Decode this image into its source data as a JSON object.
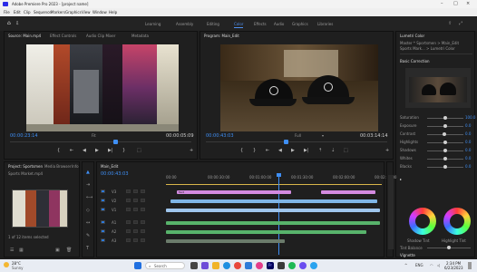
{
  "window": {
    "title": "Adobe Premiere Pro 2023 - [project name]"
  },
  "menu": [
    "File",
    "Edit",
    "Clip",
    "Sequence",
    "Markers",
    "Graphics",
    "View",
    "Window",
    "Help"
  ],
  "workspaces": [
    "Learning",
    "Assembly",
    "Editing",
    "Color",
    "Effects",
    "Audio",
    "Graphics",
    "Libraries"
  ],
  "active_workspace": "Color",
  "source": {
    "tabs": [
      "Source: Main.mp4",
      "Effect Controls",
      "Audio Clip Mixer",
      "Metadata"
    ],
    "timecode_left": "00:00:23:14",
    "timecode_right": "00:00:05:09",
    "fit": "Fit"
  },
  "program": {
    "tab": "Program: Main_Edit",
    "timecode_left": "00:00:43:03",
    "fit": "Full",
    "timecode_right": "00:03:14:14"
  },
  "transport": [
    "{",
    "⇤",
    "◀",
    "▶",
    "▶|",
    "}",
    "⬚",
    "+"
  ],
  "project": {
    "tabs": [
      "Project: Sportsmen",
      "Media Browser",
      "Info"
    ],
    "clip_name": "Sports Market.mp4",
    "item_meta": "1 of 12 items selected"
  },
  "timeline": {
    "tab": "Main_Edit",
    "timecode": "00:00:43:03",
    "ruler": [
      "00:00",
      "00:00:30:00",
      "00:01:00:00",
      "00:01:30:00",
      "00:02:00:00",
      "00:02:30:00"
    ],
    "video_tracks": [
      "V3",
      "V2",
      "V1"
    ],
    "audio_tracks": [
      "A1",
      "A2",
      "A3"
    ],
    "clips": [
      {
        "track": "V3",
        "name": "Text",
        "color": "#d38be0",
        "start": 0.05,
        "end": 0.58
      },
      {
        "track": "V3",
        "name": "",
        "color": "#d38be0",
        "start": 0.72,
        "end": 0.97
      },
      {
        "track": "V2",
        "name": "",
        "color": "#7fb5e6",
        "start": 0.02,
        "end": 0.98
      },
      {
        "track": "V1",
        "name": "",
        "color": "#9fc5ec",
        "start": 0.0,
        "end": 0.99
      },
      {
        "track": "A1",
        "name": "",
        "color": "#58b36b",
        "start": 0.0,
        "end": 0.99
      },
      {
        "track": "A2",
        "name": "",
        "color": "#58b36b",
        "start": 0.0,
        "end": 0.93
      },
      {
        "track": "A3",
        "name": "",
        "color": "#6b7b6b",
        "start": 0.0,
        "end": 0.55
      }
    ]
  },
  "lumetri": {
    "title": "Lumetri Color",
    "source_line": "Master * Sportsmen > Main_Edit",
    "clip_line": "Sports Mark... > Lumetri Color",
    "basic": "Basic Correction",
    "sliders": [
      {
        "label": "Saturation",
        "value": 0.5,
        "text": "100.0"
      },
      {
        "label": "Exposure",
        "value": 0.5,
        "text": "0.0"
      },
      {
        "label": "Contrast",
        "value": 0.48,
        "text": "0.0"
      },
      {
        "label": "Highlights",
        "value": 0.5,
        "text": "0.0"
      },
      {
        "label": "Shadows",
        "value": 0.5,
        "text": "0.0"
      },
      {
        "label": "Whites",
        "value": 0.5,
        "text": "0.0"
      },
      {
        "label": "Blacks",
        "value": 0.5,
        "text": "0.0"
      }
    ],
    "wheels": [
      "Shadow Tint",
      "Highlight Tint"
    ],
    "tint_balance": "Tint Balance",
    "vignette": "Vignette"
  },
  "taskbar": {
    "weather_temp": "28°C",
    "weather_desc": "Sunny",
    "search": "Search",
    "lang": "ENG",
    "time": "2:34 PM",
    "date": "6/23/2023"
  },
  "colors": {
    "accent": "#3f8ff5",
    "panel": "#1f1f1f",
    "bg": "#1d1d1d"
  }
}
